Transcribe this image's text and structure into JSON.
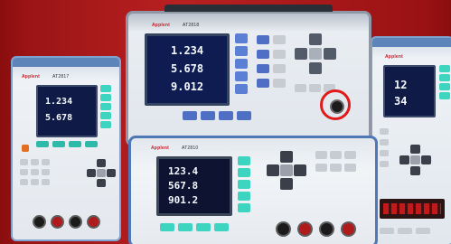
{
  "photo": {
    "subject": "electronic-measurement-instruments",
    "background_color": "#a5191b"
  },
  "instruments": {
    "left": {
      "brand_text": "Applent",
      "model_text": "AT2817",
      "screen_readings": [
        "1.234",
        "5.678"
      ]
    },
    "back_center": {
      "brand_text": "Applent",
      "model_text": "AT2818",
      "screen_readings": [
        "1.234",
        "5.678",
        "9.012"
      ],
      "highlight_color": "#e01b1b"
    },
    "right": {
      "brand_text": "Applent",
      "screen_readings": [
        "12",
        "34"
      ]
    },
    "front_center": {
      "brand_text": "Applent",
      "model_text": "AT2810",
      "screen_readings": [
        "123.4",
        "567.8",
        "901.2"
      ]
    }
  }
}
